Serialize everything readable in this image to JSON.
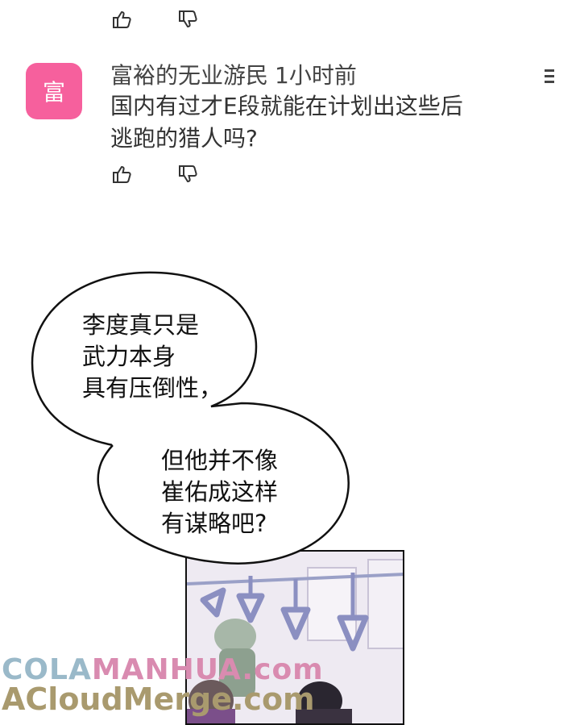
{
  "top_votes": {
    "like_icon": "thumbs-up-icon",
    "dislike_icon": "thumbs-down-icon"
  },
  "comment": {
    "avatar_char": "富",
    "avatar_color": "#f6609d",
    "username": "富裕的无业游民",
    "time": "1小时前",
    "body_line1": "国内有过才E段就能在计划出这些后",
    "body_line2": "逃跑的猎人吗?",
    "more_icon": "more-menu-icon"
  },
  "bubble1": {
    "line1": "李度真只是",
    "line2": "武力本身",
    "line3": "具有压倒性，"
  },
  "bubble2": {
    "line1": "但他并不像",
    "line2": "崔佑成这样",
    "line3": "有谋略吧?"
  },
  "watermark": {
    "part1": "COLA",
    "part2": "MANHUA.com",
    "line2": "ACloudMerge.com"
  }
}
